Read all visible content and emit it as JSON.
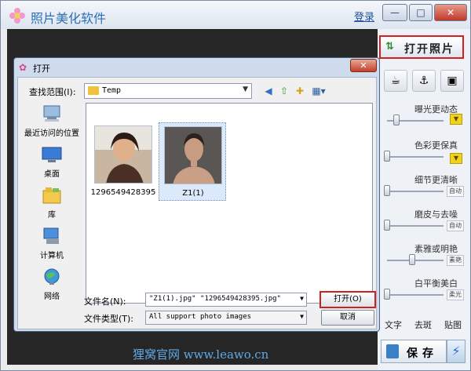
{
  "app": {
    "title": "照片美化软件",
    "login": "登录",
    "controls": [
      "—",
      "□",
      "✕"
    ],
    "watermark": "狸窝官网 www.leawo.cn"
  },
  "right_panel": {
    "open_photo": "打开照片",
    "adjustments": [
      {
        "label": "曝光更动态",
        "level": 0.12,
        "side": "drop"
      },
      {
        "label": "色彩更保真",
        "level": 0.0,
        "side": "drop"
      },
      {
        "label": "细节更清晰",
        "level": 0.0,
        "side": "auto",
        "auto": "自动"
      },
      {
        "label": "磨皮与去噪",
        "level": 0.0,
        "side": "auto",
        "auto": "自动"
      },
      {
        "label": "素雅或明艳",
        "level": 0.5,
        "side": "auto",
        "auto": "素艳"
      },
      {
        "label": "白平衡美白",
        "level": 0.0,
        "side": "auto",
        "auto": "柔光"
      }
    ],
    "tabs": [
      "文字",
      "去斑",
      "贴图"
    ],
    "save": "保存"
  },
  "dialog": {
    "title": "打开",
    "look_in_label": "查找范围(I):",
    "look_in_value": "Temp",
    "places": [
      "最近访问的位置",
      "桌面",
      "库",
      "计算机",
      "网络"
    ],
    "files": [
      {
        "name": "1296549428395"
      },
      {
        "name": "Z1(1)"
      }
    ],
    "file_name_label": "文件名(N):",
    "file_name_value": "\"Z1(1).jpg\" \"1296549428395.jpg\"",
    "file_type_label": "文件类型(T):",
    "file_type_value": "All support photo images",
    "open_button": "打开(O)",
    "cancel_button": "取消"
  }
}
